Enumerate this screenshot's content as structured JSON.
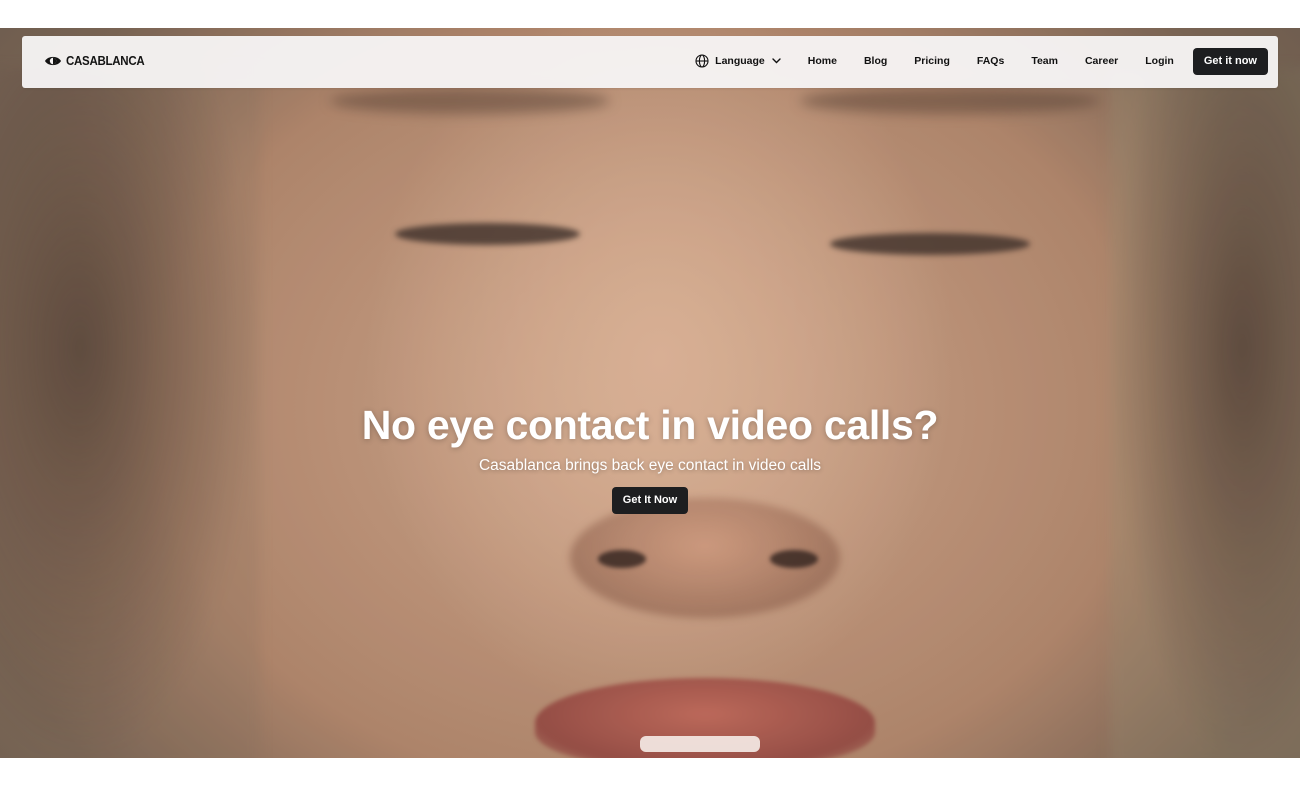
{
  "brand": {
    "name": "CASABLANCA",
    "logo_icon": "eye-logo-icon"
  },
  "nav": {
    "language": {
      "label": "Language",
      "icon": "globe-icon",
      "dropdown_icon": "chevron-down-icon"
    },
    "links": [
      "Home",
      "Blog",
      "Pricing",
      "FAQs",
      "Team",
      "Career",
      "Login"
    ],
    "cta_label": "Get it now"
  },
  "hero": {
    "headline": "No eye contact in video calls?",
    "subheadline": "Casablanca brings back eye contact in video calls",
    "cta_label": "Get It Now"
  },
  "colors": {
    "button_bg": "#1d1e20",
    "navbar_bg": "#f6f4f4",
    "hero_text": "#ffffff"
  }
}
